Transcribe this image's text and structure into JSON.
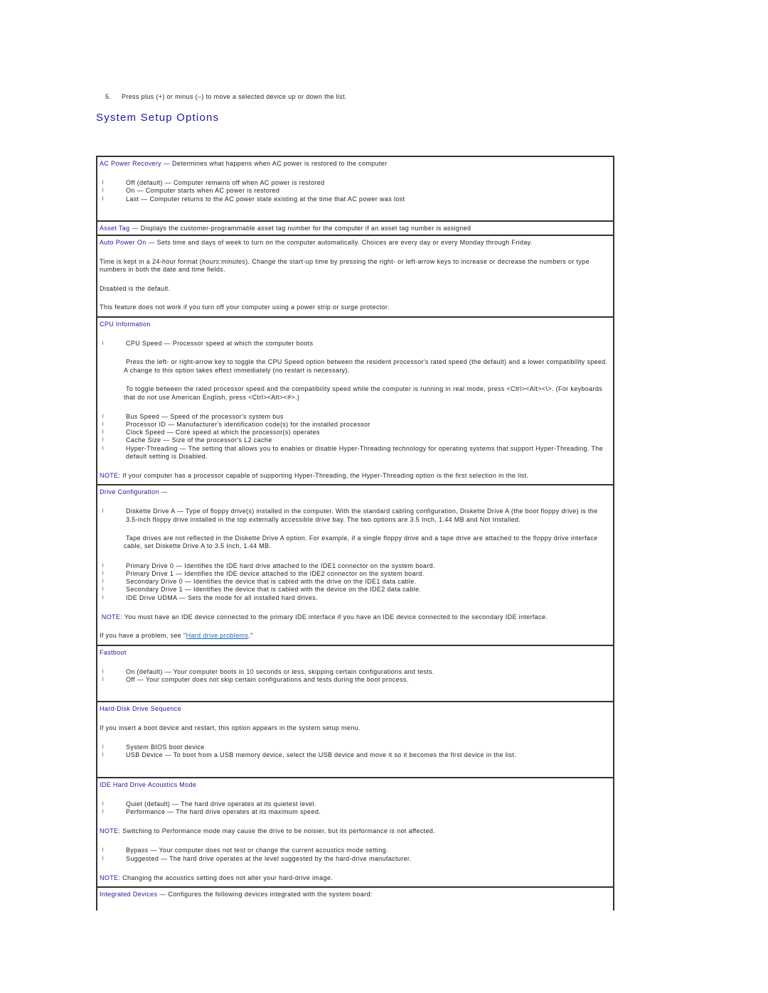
{
  "step": {
    "number": "5.",
    "text": "Press plus (+) or minus (–) to move a selected device up or down the list."
  },
  "title": "System Setup Options",
  "colors": {
    "heading": "#1a1a9e",
    "link": "#1565c0",
    "border": "#333333"
  },
  "options": {
    "ac_power_recovery": {
      "name": "AC Power Recovery",
      "dash": " — ",
      "desc": "Determines what happens when AC power is restored to the computer",
      "items": [
        "Off (default) — Computer remains off when AC power is restored",
        "On — Computer starts when AC power is restored",
        "Last — Computer returns to the AC power state existing at the time that AC power was lost"
      ]
    },
    "asset_tag": {
      "name": "Asset Tag",
      "dash": " — ",
      "desc": "Displays the customer-programmable asset tag number for the computer if an asset tag number is assigned"
    },
    "auto_power_on": {
      "name": "Auto Power On",
      "dash": " — ",
      "desc": "Sets time and days of week to turn on the computer automatically. Choices are every day or every Monday through Friday.",
      "p1_before": " Time is kept in a 24-hour format (",
      "p1_italic": "hours:minutes",
      "p1_after": "). Change the start-up time by pressing the right- or left-arrow keys to increase or decrease the numbers or type numbers in both the date and time fields.",
      "p2": " Disabled is the default.",
      "p3": " This feature does not work if you turn off your computer using a power strip or surge protector."
    },
    "cpu_information": {
      "name": "CPU Information",
      "item_first": "CPU Speed — Processor speed at which the computer boots",
      "p1": "Press the left- or right-arrow key to toggle the CPU Speed option between the resident processor's rated speed (the default) and a lower compatibility speed. A change to this option takes effect immediately (no restart is necessary).",
      "p2": "To toggle between the rated processor speed and the compatibility speed while the computer is running in real mode, press <Ctrl><Alt><\\>. (For keyboards that do not use American English, press <Ctrl><Alt><#>.)",
      "items": [
        "Bus Speed — Speed of the processor's system bus",
        "Processor ID — Manufacturer's identification code(s) for the installed processor",
        "Clock Speed — Core speed at which the processor(s) operates",
        "Cache Size — Size of the processor's L2 cache",
        "Hyper-Threading — The setting that allows you to enables or disable Hyper-Threading technology for operating systems that support Hyper-Threading. The default setting is Disabled."
      ],
      "note_label": "NOTE:",
      "note": " If your computer has a processor capable of supporting Hyper-Threading, the Hyper-Threading option is the first selection in the list."
    },
    "drive_configuration": {
      "name": "Drive Configuration",
      "dash": " —",
      "item_first": "Diskette Drive A — Type of floppy drive(s) installed in the computer. With the standard cabling configuration, Diskette Drive A (the boot floppy drive) is the 3.5-inch floppy drive installed in the top externally accessible drive bay. The two options are 3.5 Inch, 1.44 MB and Not Installed.",
      "p1": "Tape drives are not reflected in the Diskette Drive A option. For example, if a single floppy drive and a tape drive are attached to the floppy drive interface cable, set Diskette Drive A to 3.5 Inch, 1.44 MB.",
      "items": [
        "Primary Drive 0 — Identifies the IDE hard drive attached to the IDE1 connector on the system board.",
        "Primary Drive 1 — Identifies the IDE device attached to the IDE2 connector on the system board.",
        "Secondary Drive 0 — Identifies the device that is cabled with the drive on the IDE1 data cable.",
        "Secondary Drive 1 — Identifies the device that is cabled with the device on the IDE2 data cable.",
        "IDE Drive UDMA — Sets the mode for all installed hard drives."
      ],
      "note_label": "NOTE:",
      "note": " You must have an IDE device connected to the primary IDE interface if you have an IDE device connected to the secondary IDE interface.",
      "problem_before": " If you have a problem, see \"",
      "problem_link": "Hard drive problems",
      "problem_after": ".\""
    },
    "fastboot": {
      "name": "Fastboot",
      "items": [
        "On (default) — Your computer boots in 10 seconds or less, skipping certain configurations and tests.",
        "Off — Your computer does not skip certain configurations and tests during the boot process."
      ]
    },
    "hdd_sequence": {
      "name": "Hard-Disk Drive Sequence",
      "p1": " If you insert a boot device and restart, this option appears in the system setup menu.",
      "items": [
        "System BIOS boot device",
        "USB Device — To boot from a USB memory device, select the USB device and move it so it becomes the first device in the list."
      ]
    },
    "ide_acoustics": {
      "name": "IDE Hard Drive Acoustics Mode",
      "items_a": [
        "Quiet (default) — The hard drive operates at its quietest level.",
        "Performance — The hard drive operates at its maximum speed."
      ],
      "note1_label": "NOTE:",
      "note1": " Switching to Performance mode may cause the drive to be noisier, but its performance is not affected.",
      "items_b": [
        "Bypass — Your computer does not test or change the current acoustics mode setting.",
        "Suggested — The hard drive operates at the level suggested by the hard-drive manufacturer."
      ],
      "note2_label": "NOTE:",
      "note2": " Changing the acoustics setting does not alter your hard-drive image."
    },
    "integrated_devices": {
      "name": "Integrated Devices",
      "dash": " — ",
      "desc": "Configures the following devices integrated with the system board:"
    }
  },
  "bullet_glyph": "l"
}
